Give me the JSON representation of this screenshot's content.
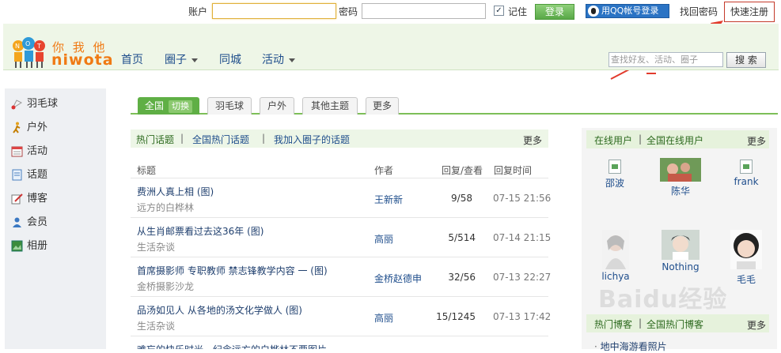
{
  "login": {
    "account_label": "账户",
    "account_value": "",
    "password_label": "密码",
    "password_value": "",
    "remember_label": "记住",
    "remember_checked": "✓",
    "login_button": "登录",
    "qq_login": "用QQ帐号登录",
    "find_password": "找回密码",
    "quick_register": "快速注册"
  },
  "header": {
    "logo_cn": "你 我 他",
    "logo_en": "niwota",
    "nav": [
      "首页",
      "圈子",
      "同城",
      "活动"
    ],
    "search_placeholder": "查找好友、活动、圈子",
    "search_button": "搜 索"
  },
  "sidebar": {
    "items": [
      {
        "label": "羽毛球",
        "icon": "shuttlecock-icon"
      },
      {
        "label": "户外",
        "icon": "hiker-icon"
      },
      {
        "label": "活动",
        "icon": "calendar-icon"
      },
      {
        "label": "话题",
        "icon": "document-icon"
      },
      {
        "label": "博客",
        "icon": "pen-icon"
      },
      {
        "label": "会员",
        "icon": "user-icon"
      },
      {
        "label": "相册",
        "icon": "photo-icon"
      }
    ]
  },
  "tabs": {
    "active": "全国",
    "switch": "切换",
    "others": [
      "羽毛球",
      "户外",
      "其他主题",
      "更多"
    ]
  },
  "topics": {
    "head_links": [
      "热门话题",
      "全国热门话题",
      "我加入圈子的话题"
    ],
    "more": "更多",
    "columns": [
      "标题",
      "作者",
      "回复/查看",
      "回复时间"
    ],
    "rows": [
      {
        "title": "费洲人真上相 (图)",
        "group": "远方的白桦林",
        "author": "王新新",
        "reply": "9/58",
        "time": "07-15 21:56"
      },
      {
        "title": "从生肖邮票看过去这36年 (图)",
        "group": "生活杂谈",
        "author": "高丽",
        "reply": "5/514",
        "time": "07-14 21:15"
      },
      {
        "title": "首席摄影师 专职教师 禁志锋教学内容 一 (图)",
        "group": "金桥摄影沙龙",
        "author": "金桥赵德申",
        "reply": "32/56",
        "time": "07-13 22:27"
      },
      {
        "title": "品汤如见人 从各地的汤文化学做人 (图)",
        "group": "生活杂谈",
        "author": "高丽",
        "reply": "15/1245",
        "time": "07-13 17:42"
      },
      {
        "title": "难忘的快乐时光，纪念远方的白桦林不要图片",
        "group": "",
        "author": "",
        "reply": "",
        "time": ""
      }
    ]
  },
  "online": {
    "head_links": [
      "在线用户",
      "全国在线用户"
    ],
    "more": "更多",
    "users": [
      "邵波",
      "陈华",
      "frank",
      "lichya",
      "Nothing",
      "毛毛"
    ]
  },
  "hot_blogs": {
    "head_links": [
      "热门博客",
      "全国热门博客"
    ],
    "more": "更多",
    "items": [
      "地中海游看照片"
    ]
  },
  "watermark": "Baidu经验"
}
